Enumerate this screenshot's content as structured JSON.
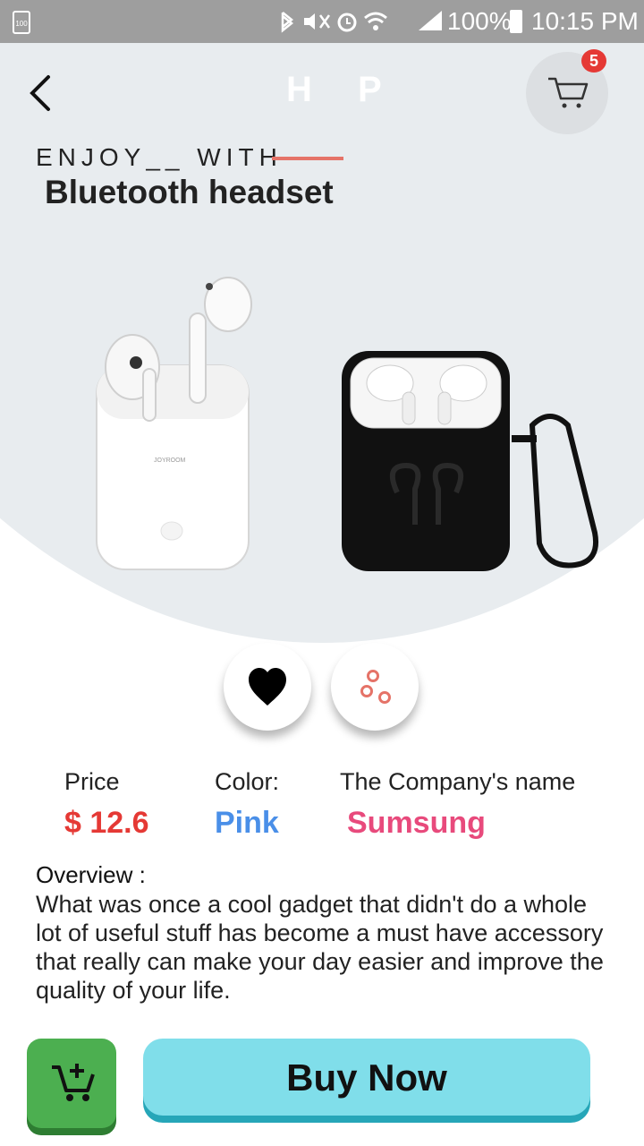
{
  "status_bar": {
    "left_icon_text": "100",
    "battery_percent": "100%",
    "time": "10:15 PM"
  },
  "header": {
    "brand": "H P",
    "cart_count": "5"
  },
  "product": {
    "tagline": "ENJOY__ WITH",
    "title": "Bluetooth headset",
    "case_brand_text": "JOYROOM"
  },
  "details": {
    "price_label": "Price",
    "price_value": "$ 12.6",
    "color_label": "Color:",
    "color_value": "Pink",
    "company_label": "The Company's name",
    "company_value": "Sumsung"
  },
  "overview": {
    "title": "Overview :",
    "text": " What was once a cool gadget that didn't do a whole lot of useful stuff has become a must have accessory that really can make your day easier and improve the quality of your life."
  },
  "actions": {
    "buy_now_label": "Buy Now"
  },
  "colors": {
    "price": "#e53935",
    "color_value": "#4a8fe8",
    "company_value": "#e84a7c",
    "buy_button": "#80deea",
    "cart_button": "#4caf50",
    "badge": "#e53935"
  },
  "icons": [
    "back-chevron-icon",
    "cart-icon",
    "heart-icon",
    "share-icon",
    "add-to-cart-icon"
  ]
}
